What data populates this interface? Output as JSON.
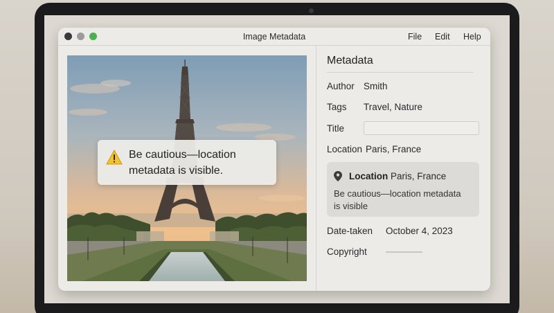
{
  "window": {
    "title": "Image Metadata",
    "menu": [
      "File",
      "Edit",
      "Help"
    ]
  },
  "toast": {
    "icon": "warning-icon",
    "line1": "Be cautious—location",
    "line2": "metadata is visible."
  },
  "panel": {
    "title": "Metadata",
    "author_label": "Author",
    "author_value": "Smith",
    "tags_label": "Tags",
    "tags_value": "Travel, Nature",
    "title_label": "Title",
    "title_value": "",
    "location_label": "Location",
    "location_value": "Paris, France",
    "location_card": {
      "icon": "map-pin-icon",
      "label": "Location",
      "value": "Paris, France",
      "warning_line1": "Be cautious—location metadata",
      "warning_line2": "is visible"
    },
    "date_label": "Date-taken",
    "date_value": "October 4, 2023",
    "copyright_label": "Copyright",
    "copyright_value": ""
  },
  "colors": {
    "window_bg": "#ecebe8",
    "card_bg": "#dcdbd7",
    "close_light": "#3a3a3a",
    "min_light": "#9b9b9b",
    "max_light": "#4caf50",
    "warning": "#f2c230"
  }
}
